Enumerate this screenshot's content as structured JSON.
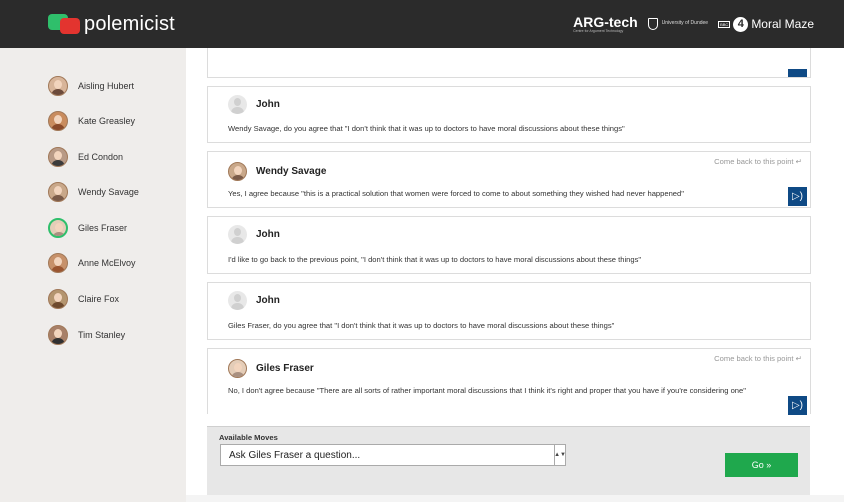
{
  "header": {
    "app_name": "polemicist",
    "argtech": "ARG-tech",
    "argtech_sub": "Centre for Argument Technology",
    "university": "University of Dundee",
    "bbc": "BBC",
    "radio4": "4",
    "programme": "Moral Maze"
  },
  "sidebar": {
    "participants": [
      {
        "name": "Aisling Hubert"
      },
      {
        "name": "Kate Greasley"
      },
      {
        "name": "Ed Condon"
      },
      {
        "name": "Wendy Savage"
      },
      {
        "name": "Giles Fraser",
        "selected": true
      },
      {
        "name": "Anne McElvoy"
      },
      {
        "name": "Claire Fox"
      },
      {
        "name": "Tim Stanley"
      }
    ]
  },
  "dialogue": {
    "come_back_label": "Come back to this point ↵",
    "audio_icon": "audio-icon",
    "messages": [
      {
        "speaker": "John",
        "text": "Wendy Savage, do you agree that \"I don't think that it was up to doctors to have moral discussions about these things\""
      },
      {
        "speaker": "Wendy Savage",
        "text": "Yes, I agree because \"this is a practical solution that women were forced to come to about something they wished had never happened\""
      },
      {
        "speaker": "John",
        "text": "I'd like to go back to the previous point, \"I don't think that it was up to doctors to have moral discussions about these things\""
      },
      {
        "speaker": "John",
        "text": "Giles Fraser, do you agree that \"I don't think that it was up to doctors to have moral discussions about these things\""
      },
      {
        "speaker": "Giles Fraser",
        "text": "No, I don't agree because \"There are all sorts of rather important moral discussions that I think it's right and proper that you have if you're considering one\""
      }
    ]
  },
  "moves": {
    "label": "Available Moves",
    "selected": "Ask Giles Fraser a question...",
    "go_label": "Go »"
  },
  "colors": {
    "header_bg": "#2b2b2b",
    "sidebar_bg": "#efedeb",
    "accent_green": "#1fa84d",
    "audio_blue": "#0f4a85"
  }
}
